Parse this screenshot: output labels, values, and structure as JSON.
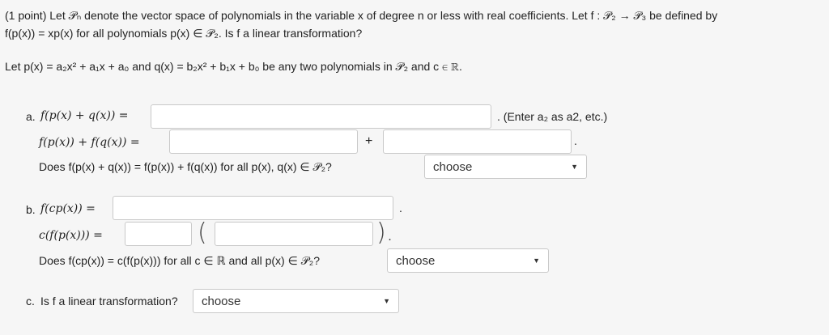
{
  "problem": {
    "line1": "(1 point) Let 𝒫ₙ denote the vector space of polynomials in the variable x of degree n or less with real coefficients. Let f : 𝒫₂ → 𝒫₃ be defined by",
    "line2": "f(p(x)) = xp(x) for all polynomials p(x) ∈ 𝒫₂. Is f a linear transformation?",
    "line3": "Let p(x) = a₂x² + a₁x + a₀ and q(x) = b₂x² + b₁x + b₀ be any two polynomials in 𝒫₂ and c ∈ ℝ."
  },
  "part_a": {
    "label": "a.",
    "row1_lhs": "f(p(x) + q(x)) =",
    "row1_hint": ". (Enter a₂ as a2, etc.)",
    "row2_lhs": "f(p(x)) + f(q(x)) =",
    "plus": "+",
    "row2_end": ".",
    "question": "Does f(p(x) + q(x)) = f(p(x)) + f(q(x)) for all p(x), q(x) ∈ 𝒫₂?",
    "select_value": "choose"
  },
  "part_b": {
    "label": "b.",
    "row1_lhs": "f(cp(x)) =",
    "row1_end": ".",
    "row2_lhs": "c(f(p(x))) =",
    "open_paren": "(",
    "close_paren": ").",
    "question": "Does f(cp(x)) = c(f(p(x))) for all c ∈ ℝ and all p(x) ∈ 𝒫₂?",
    "select_value": "choose"
  },
  "part_c": {
    "label": "c.",
    "question": "Is f a linear transformation?",
    "select_value": "choose"
  },
  "icons": {
    "dropdown": "chevron-down-icon"
  }
}
